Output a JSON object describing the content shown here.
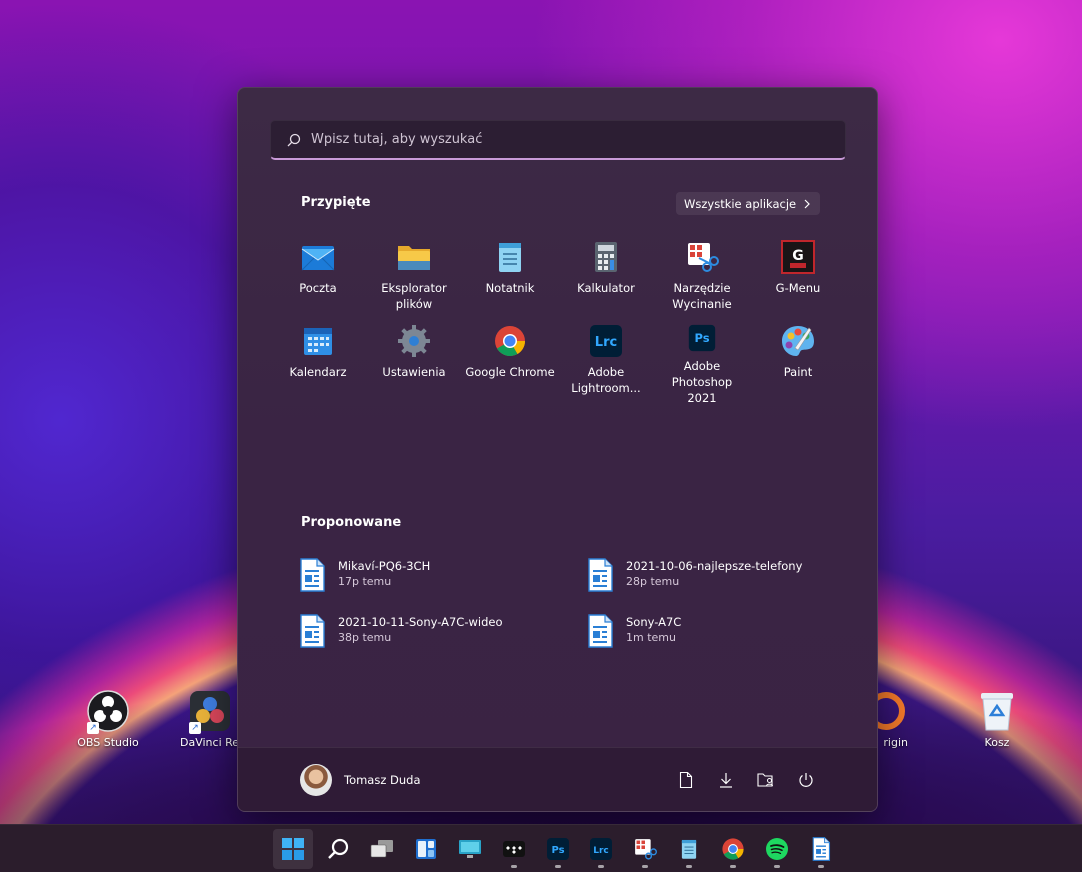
{
  "desktop": {
    "icons": [
      {
        "label": "OBS Studio"
      },
      {
        "label": "DaVinci Res"
      },
      {
        "label": "rigin"
      },
      {
        "label": "Kosz"
      }
    ]
  },
  "start_menu": {
    "search": {
      "placeholder": "Wpisz tutaj, aby wyszukać"
    },
    "pinned": {
      "title": "Przypięte",
      "all_apps_label": "Wszystkie aplikacje",
      "apps": [
        {
          "label": "Poczta",
          "icon": "mail-icon"
        },
        {
          "label": "Eksplorator plików",
          "icon": "folder-icon"
        },
        {
          "label": "Notatnik",
          "icon": "notepad-icon"
        },
        {
          "label": "Kalkulator",
          "icon": "calculator-icon"
        },
        {
          "label": "Narzędzie Wycinanie",
          "icon": "snipping-tool-icon"
        },
        {
          "label": "G-Menu",
          "icon": "g-menu-icon"
        },
        {
          "label": "Kalendarz",
          "icon": "calendar-icon"
        },
        {
          "label": "Ustawienia",
          "icon": "settings-gear-icon"
        },
        {
          "label": "Google Chrome",
          "icon": "chrome-icon"
        },
        {
          "label": "Adobe Lightroom...",
          "icon": "lightroom-icon"
        },
        {
          "label": "Adobe Photoshop 2021",
          "icon": "photoshop-icon"
        },
        {
          "label": "Paint",
          "icon": "paint-palette-icon"
        }
      ]
    },
    "recommended": {
      "title": "Proponowane",
      "items": [
        {
          "name": "Mikaví-PQ6-3CH",
          "time": "17p temu"
        },
        {
          "name": "2021-10-06-najlepsze-telefony",
          "time": "28p temu"
        },
        {
          "name": "2021-10-11-Sony-A7C-wideo",
          "time": "38p temu"
        },
        {
          "name": "Sony-A7C",
          "time": "1m temu"
        }
      ]
    },
    "footer": {
      "user_name": "Tomasz Duda"
    }
  },
  "taskbar": {
    "items": [
      "start-icon",
      "search-icon",
      "task-view-icon",
      "widgets-icon",
      "monitor-app-icon",
      "tidal-icon",
      "photoshop-icon",
      "lightroom-icon",
      "snipping-tool-icon",
      "notepad-icon",
      "chrome-icon",
      "spotify-icon",
      "document-writer-icon"
    ]
  },
  "colors": {
    "menu_bg": "#3a2444",
    "search_accent": "#c99ad8",
    "taskbar_bg": "#2b1d2c"
  }
}
